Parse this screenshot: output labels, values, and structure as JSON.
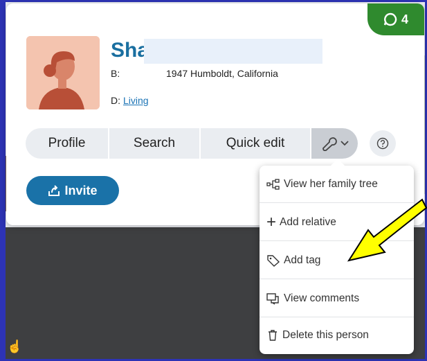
{
  "badge": {
    "count": "4",
    "icon": "comment-icon",
    "color": "#2f8a2e"
  },
  "person": {
    "name_visible": "Sha",
    "birth_label": "B:",
    "birth_text": "1947 Humboldt, California",
    "death_label": "D:",
    "death_value": "Living",
    "avatar_icon": "female-avatar-icon"
  },
  "buttons": {
    "profile": "Profile",
    "search": "Search",
    "quick_edit": "Quick edit",
    "tools_icon": "wrench-icon",
    "help_icon": "help-icon",
    "invite": "Invite"
  },
  "menu": {
    "items": [
      {
        "label": "View her family tree",
        "icon": "tree-icon"
      },
      {
        "label": "Add relative",
        "icon": "plus-icon"
      },
      {
        "label": "Add tag",
        "icon": "tag-icon"
      },
      {
        "label": "View comments",
        "icon": "comments-icon"
      },
      {
        "label": "Delete this person",
        "icon": "trash-icon"
      }
    ]
  },
  "colors": {
    "accent": "#1a72a8",
    "name": "#1a6fa0",
    "arrow": "#ffff00",
    "frame": "#2d33b5"
  }
}
